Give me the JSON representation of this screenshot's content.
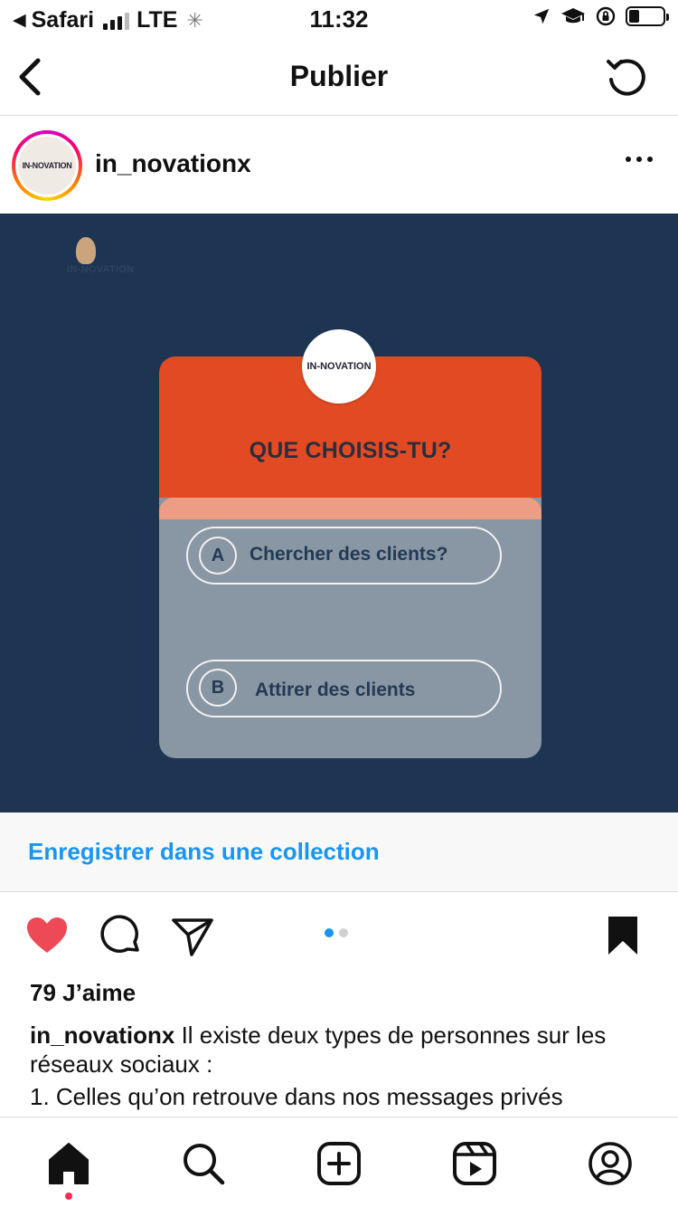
{
  "status_bar": {
    "back_app": "Safari",
    "carrier": "LTE",
    "time": "11:32",
    "battery_level": 0.3
  },
  "nav": {
    "title": "Publier",
    "back_icon": "chevron-left-icon",
    "refresh_icon": "refresh-icon"
  },
  "post": {
    "username": "in_novationx",
    "avatar_text": "IN-NOVATION",
    "image": {
      "watermark": "IN-NOVATION",
      "logo_text": "IN-NOVATION",
      "quiz_title": "QUE CHOISIS-TU?",
      "options": [
        {
          "letter": "A",
          "text": "Chercher des clients?"
        },
        {
          "letter": "B",
          "text": "Attirer des clients"
        }
      ]
    },
    "save_collection_label": "Enregistrer dans une collection",
    "likes": "79 J’aime",
    "caption_user": "in_novationx",
    "caption_text": " Il existe deux types de personnes sur les réseaux sociaux :",
    "caption_line2": "1. Celles qu’on retrouve dans nos messages privés",
    "carousel": {
      "count": 2,
      "active": 1
    },
    "liked": true,
    "saved": true
  },
  "colors": {
    "accent_blue": "#1a95f0",
    "like_red": "#ed4956",
    "image_bg": "#1d3552",
    "quiz_orange": "#e24a23",
    "quiz_gray": "#8996a3"
  },
  "tab_bar": {
    "items": [
      "home-icon",
      "search-icon",
      "create-icon",
      "reels-icon",
      "profile-icon"
    ],
    "active": "home-icon"
  }
}
